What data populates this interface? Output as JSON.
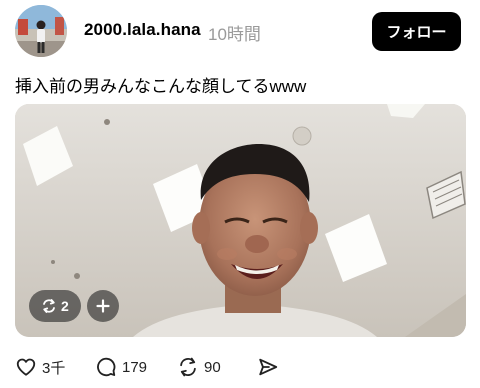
{
  "post": {
    "username": "2000.lala.hana",
    "timestamp": "10時間",
    "follow_label": "フォロー",
    "caption": "挿入前の男みんなこんな顔してるwww"
  },
  "media": {
    "repost_count": "2"
  },
  "actions": {
    "likes": "3千",
    "replies": "179",
    "reposts": "90"
  },
  "icons": {
    "like": "heart-icon",
    "reply": "comment-icon",
    "repost": "repost-icon",
    "share": "send-icon",
    "add": "plus-icon"
  },
  "colors": {
    "follow_bg": "#000000",
    "follow_text": "#ffffff",
    "timestamp": "#9a9a9a",
    "badge_bg": "rgba(40,40,40,0.62)"
  }
}
